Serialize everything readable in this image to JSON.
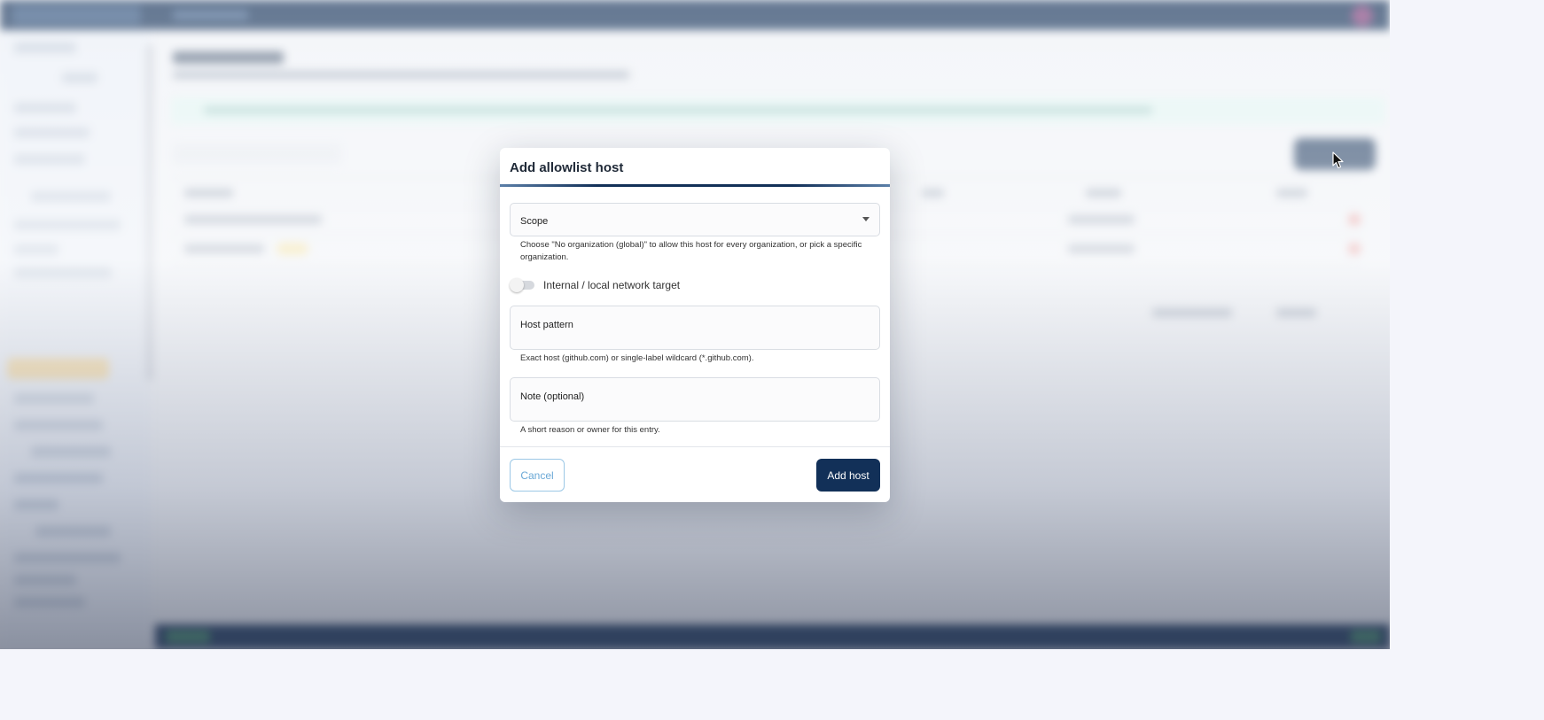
{
  "dialog": {
    "title": "Add allowlist host",
    "scope": {
      "label": "Scope",
      "helper": "Choose \"No organization (global)\" to allow this host for every organization, or pick a specific organization."
    },
    "internal_toggle": {
      "label": "Internal / local network target",
      "checked": false
    },
    "host_pattern": {
      "label": "Host pattern",
      "helper": "Exact host (github.com) or single-label wildcard (*.github.com)."
    },
    "note": {
      "label": "Note (optional)",
      "helper": "A short reason or owner for this entry."
    },
    "cancel_label": "Cancel",
    "submit_label": "Add host"
  },
  "colors": {
    "primary": "#123058",
    "cancel_outline": "#9cc8e6",
    "cancel_text": "#6aa8d6"
  },
  "icons": {
    "scope_dropdown": "chevron-down-icon",
    "cursor": "mouse-pointer-icon"
  }
}
